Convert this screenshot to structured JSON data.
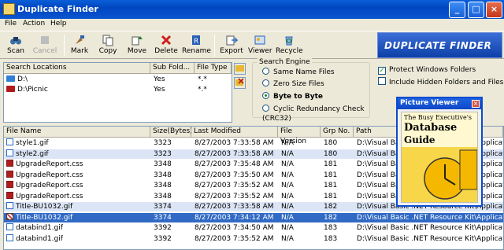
{
  "window": {
    "title": "Duplicate Finder",
    "controls": [
      "_",
      "□",
      "×"
    ]
  },
  "menu": [
    "File",
    "Action",
    "Help"
  ],
  "toolbar": {
    "buttons": [
      {
        "label": "Scan",
        "icon": "binoculars-icon"
      },
      {
        "label": "Cancel",
        "icon": "cancel-icon",
        "disabled": true
      },
      {
        "label": "Mark",
        "icon": "brush-icon"
      },
      {
        "label": "Copy",
        "icon": "copy-icon"
      },
      {
        "label": "Move",
        "icon": "move-icon"
      },
      {
        "label": "Delete",
        "icon": "delete-icon"
      },
      {
        "label": "Rename",
        "icon": "rename-icon"
      },
      {
        "label": "Export",
        "icon": "export-icon"
      },
      {
        "label": "Viewer",
        "icon": "viewer-icon"
      },
      {
        "label": "Recycle",
        "icon": "recycle-icon"
      }
    ]
  },
  "logo": {
    "text": "DUPLICATE FINDER"
  },
  "locations": {
    "headers": [
      "Search Locations",
      "Sub Fold...",
      "File Type"
    ],
    "rows": [
      {
        "path": "D:\\",
        "sub": "Yes",
        "type": "*.*",
        "color": "#2f7fd6"
      },
      {
        "path": "D:\\Picnic",
        "sub": "Yes",
        "type": "*.*",
        "color": "#b01a1a"
      }
    ]
  },
  "search_engine": {
    "legend": "Search Engine",
    "options": [
      "Same Name Files",
      "Zero Size Files",
      "Byte to Byte",
      "Cyclic Redundancy Check (CRC32)"
    ],
    "selected": "Byte to Byte"
  },
  "options": {
    "protect": {
      "label": "Protect Windows Folders",
      "checked": true
    },
    "hidden": {
      "label": "Include Hidden Folders and Files",
      "checked": false
    }
  },
  "results": {
    "headers": [
      "File Name",
      "Size(Bytes)",
      "Last Modified",
      "File Version",
      "Grp No.",
      "Path"
    ],
    "rows": [
      {
        "icon": "gif",
        "name": "style1.gif",
        "size": "3323",
        "modified": "8/27/2003 7:33:58 AM",
        "version": "N/A",
        "grp": "180",
        "path": "D:\\Visual Basic .NET Resource Kit\\Applicat",
        "alt": false
      },
      {
        "icon": "gif",
        "name": "style2.gif",
        "size": "3323",
        "modified": "8/27/2003 7:33:58 AM",
        "version": "N/A",
        "grp": "180",
        "path": "D:\\Visual Basic .NET Resource Kit\\Applicat",
        "alt": true
      },
      {
        "icon": "css",
        "name": "UpgradeReport.css",
        "size": "3348",
        "modified": "8/27/2003 7:35:48 AM",
        "version": "N/A",
        "grp": "181",
        "path": "D:\\Visual Basic .NET Resource Kit\\Applicat",
        "alt": false
      },
      {
        "icon": "css",
        "name": "UpgradeReport.css",
        "size": "3348",
        "modified": "8/27/2003 7:35:50 AM",
        "version": "N/A",
        "grp": "181",
        "path": "D:\\Visual Basic .NET Resource Kit\\Applicat",
        "alt": false
      },
      {
        "icon": "css",
        "name": "UpgradeReport.css",
        "size": "3348",
        "modified": "8/27/2003 7:35:52 AM",
        "version": "N/A",
        "grp": "181",
        "path": "D:\\Visual Basic .NET Resource Kit\\Applicat",
        "alt": false
      },
      {
        "icon": "css",
        "name": "UpgradeReport.css",
        "size": "3348",
        "modified": "8/27/2003 7:35:52 AM",
        "version": "N/A",
        "grp": "181",
        "path": "D:\\Visual Basic .NET Resource Kit\\Applicat",
        "alt": false
      },
      {
        "icon": "gif",
        "name": "Title-BU1032.gif",
        "size": "3374",
        "modified": "8/27/2003 7:33:58 AM",
        "version": "N/A",
        "grp": "182",
        "path": "D:\\Visual Basic .NET Resource Kit\\Applicat",
        "alt": true
      },
      {
        "icon": "x",
        "name": "Title-BU1032.gif",
        "size": "3374",
        "modified": "8/27/2003 7:34:12 AM",
        "version": "N/A",
        "grp": "182",
        "path": "D:\\Visual Basic .NET Resource Kit\\Applicat",
        "sel": true
      },
      {
        "icon": "gif",
        "name": "databind1.gif",
        "size": "3392",
        "modified": "8/27/2003 7:34:50 AM",
        "version": "N/A",
        "grp": "183",
        "path": "D:\\Visual Basic .NET Resource Kit\\Applicat",
        "alt": false
      },
      {
        "icon": "gif",
        "name": "databind1.gif",
        "size": "3392",
        "modified": "8/27/2003 7:35:52 AM",
        "version": "N/A",
        "grp": "183",
        "path": "D:\\Visual Basic .NET Resource Kit\\Applicat",
        "alt": false
      }
    ]
  },
  "viewer": {
    "title": "Picture Viewer",
    "close": "×",
    "book_line1": "The Busy Executive's",
    "book_line2": "Database",
    "book_line3": "Guide"
  }
}
